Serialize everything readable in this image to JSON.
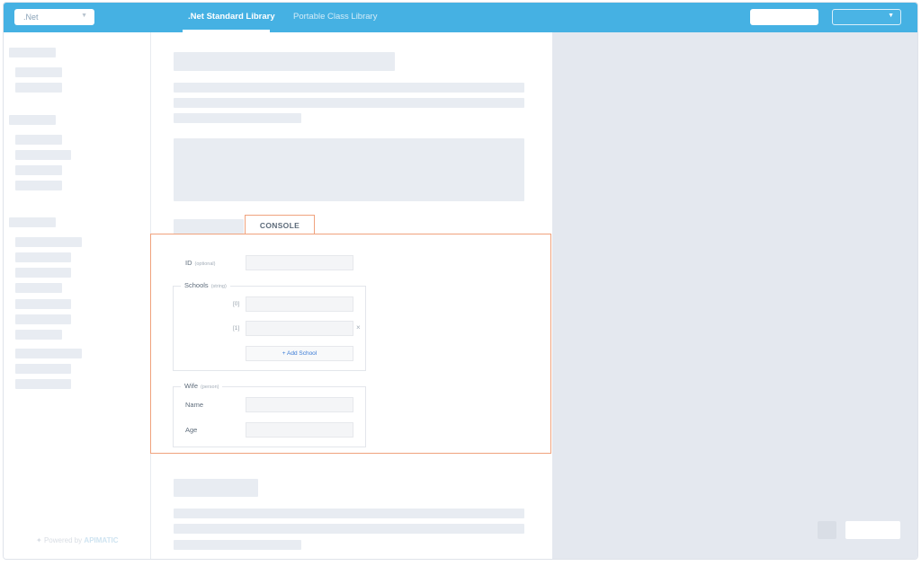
{
  "header": {
    "language_select": ".Net",
    "tabs": [
      {
        "label": ".Net Standard Library",
        "active": true
      },
      {
        "label": "Portable Class Library",
        "active": false
      }
    ]
  },
  "sidebar": {
    "powered_prefix": "Powered by",
    "powered_brand": "APIMATIC"
  },
  "console": {
    "tab_label": "CONSOLE",
    "id_label": "ID",
    "id_hint": "(optional)",
    "schools_label": "Schools",
    "schools_hint": "(string)",
    "school_items": [
      "[0]",
      "[1]"
    ],
    "remove_symbol": "×",
    "add_school_label": "+ Add School",
    "wife_label": "Wife",
    "wife_hint": "(person)",
    "name_label": "Name",
    "age_label": "Age"
  },
  "colors": {
    "topbar": "#45b1e3",
    "console_border": "#f0a27d",
    "placeholder": "#e8ecf2",
    "right_pane": "#e4e8ef"
  }
}
